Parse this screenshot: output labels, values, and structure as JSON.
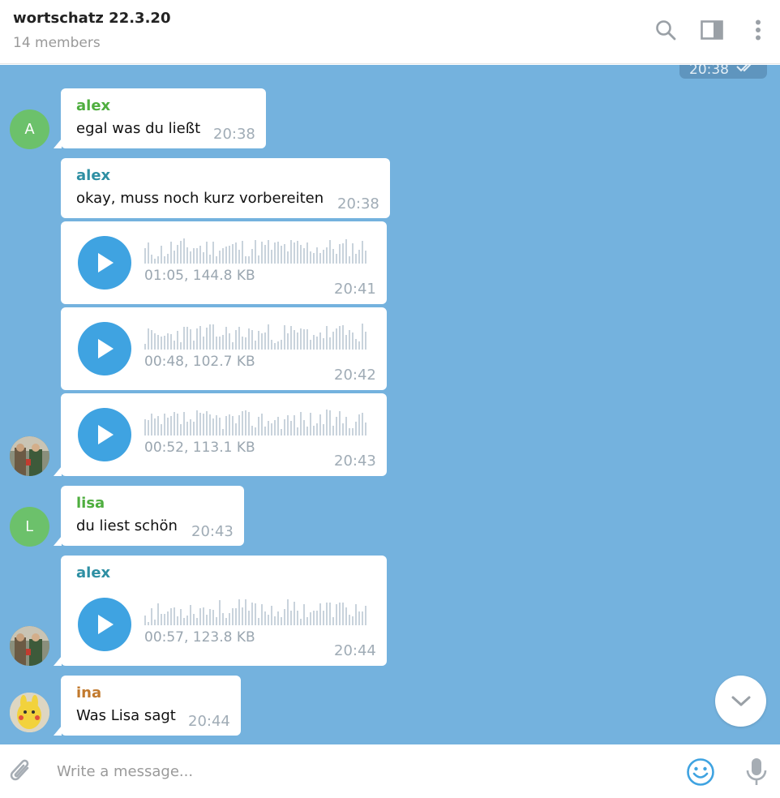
{
  "header": {
    "title": "wortschatz 22.3.20",
    "members": "14 members"
  },
  "top_message": {
    "time": "20:38"
  },
  "messages": [
    {
      "sender": "alex",
      "text": "egal was du ließt",
      "time": "20:38"
    },
    {
      "sender": "alex",
      "text": "okay, muss noch kurz vorbereiten",
      "time": "20:38"
    },
    {
      "voice_info": "01:05, 144.8 KB",
      "time": "20:41"
    },
    {
      "voice_info": "00:48, 102.7 KB",
      "time": "20:42"
    },
    {
      "voice_info": "00:52, 113.1 KB",
      "time": "20:43"
    },
    {
      "sender": "lisa",
      "text": "du liest schön",
      "time": "20:43"
    },
    {
      "sender": "alex",
      "voice_info": "00:57, 123.8 KB",
      "time": "20:44"
    },
    {
      "sender": "ina",
      "text": "Was Lisa sagt",
      "time": "20:44"
    }
  ],
  "avatars": {
    "alex_letter": "A",
    "lisa_letter": "L"
  },
  "composer": {
    "placeholder": "Write a message..."
  },
  "colors": {
    "chat_background": "#74b2de",
    "alex_green": "#4fae3f",
    "alex_teal": "#2e8fa3",
    "lisa_green": "#4fae3f",
    "ina_orange": "#c27a2e",
    "play_blue": "#3fa3e1",
    "icon_blue": "#3fa3e1"
  },
  "icons": {
    "header": [
      "search-icon",
      "sidebar-toggle-icon",
      "more-vertical-icon"
    ],
    "composer": [
      "paperclip-icon",
      "emoji-icon",
      "microphone-icon"
    ],
    "scroll": "chevron-down-icon",
    "read_status": "double-check-icon",
    "play": "play-icon"
  }
}
